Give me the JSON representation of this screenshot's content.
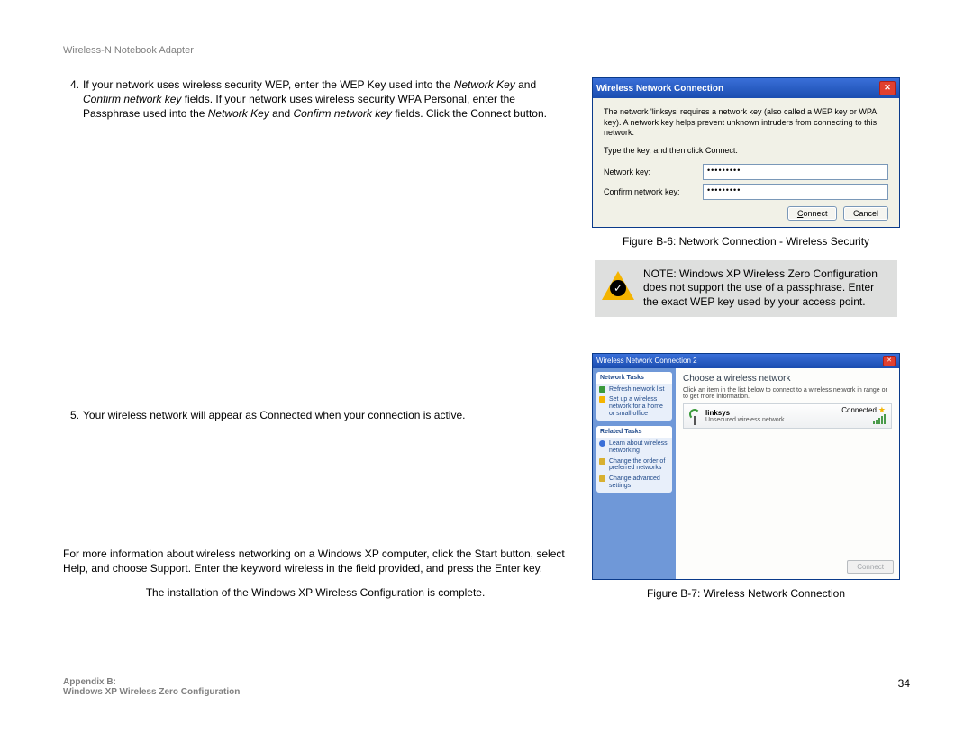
{
  "header": "Wireless-N Notebook Adapter",
  "items": {
    "n4": {
      "num": "4.",
      "t1": "If your network uses wireless security WEP, enter the WEP Key used into the ",
      "i1": "Network Key",
      "t2": " and ",
      "i2": "Confirm network key",
      "t3": " fields. If your network uses wireless security WPA Personal, enter the Passphrase used into the ",
      "i3": "Network Key",
      "t4": " and ",
      "i4": "Confirm network key",
      "t5": " fields. Click the Connect button."
    },
    "n5": {
      "num": "5.",
      "text": "Your wireless network will appear as Connected when your connection is active."
    },
    "para": "For more information about wireless networking on a Windows XP computer, click the Start button, select Help, and choose Support. Enter the keyword wireless in the field provided, and press the Enter key.",
    "completion": "The installation of the Windows XP Wireless Configuration is complete."
  },
  "dlg1": {
    "title": "Wireless Network Connection",
    "desc": "The network 'linksys' requires a network key (also called a WEP key or WPA key). A network key helps prevent unknown intruders from connecting to this network.",
    "type": "Type the key, and then click Connect.",
    "label1a": "Network ",
    "label1u": "k",
    "label1b": "ey:",
    "label2": "Confirm network key:",
    "mask": "•••••••••",
    "btnC_u": "C",
    "btnC_r": "onnect",
    "btn2": "Cancel"
  },
  "caption1": "Figure B-6: Network Connection - Wireless Security",
  "note": {
    "bold": "NOTE: ",
    "text": "Windows XP Wireless Zero Configuration does not support the use of a passphrase. Enter the exact WEP key used by your access point."
  },
  "dlg2": {
    "title": "Wireless Network Connection 2",
    "side1_head": "Network Tasks",
    "side1_a": "Refresh network list",
    "side1_b": "Set up a wireless network for a home or small office",
    "side2_head": "Related Tasks",
    "side2_a": "Learn about wireless networking",
    "side2_b": "Change the order of preferred networks",
    "side2_c": "Change advanced settings",
    "main_head": "Choose a wireless network",
    "main_sub": "Click an item in the list below to connect to a wireless network in range or to get more information.",
    "net_name": "linksys",
    "net_sub": "Unsecured wireless network",
    "net_status": "Connected",
    "btn": "Connect"
  },
  "caption2": "Figure B-7: Wireless Network Connection",
  "footer": {
    "l1": "Appendix B:",
    "l2": "Windows XP Wireless Zero Configuration",
    "page": "34"
  }
}
